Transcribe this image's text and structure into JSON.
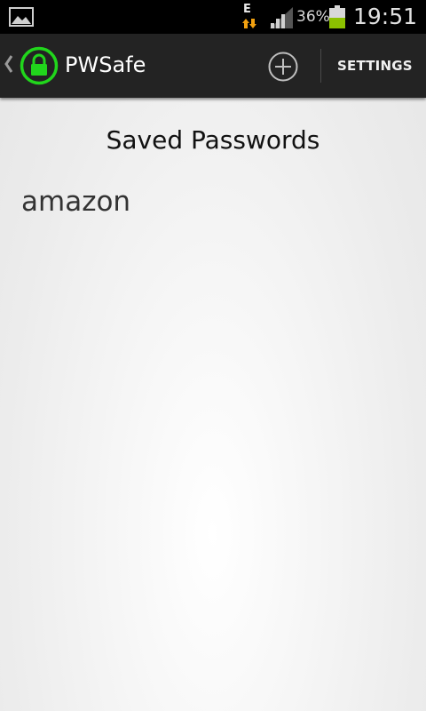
{
  "status_bar": {
    "network_type": "E",
    "battery_percent": "36%",
    "time": "19:51",
    "icons": [
      "image-notification-icon",
      "data-transfer-icon",
      "signal-strength-icon",
      "battery-icon"
    ],
    "battery_level": 0.36,
    "battery_color": "#8cc200"
  },
  "action_bar": {
    "title": "PWSafe",
    "icons": [
      "up-caret-icon",
      "lock-icon",
      "add-circle-icon"
    ],
    "lock_icon_color": "#21d61c",
    "settings_label": "SETTINGS"
  },
  "main": {
    "heading": "Saved Passwords",
    "items": [
      {
        "label": "amazon"
      }
    ]
  }
}
